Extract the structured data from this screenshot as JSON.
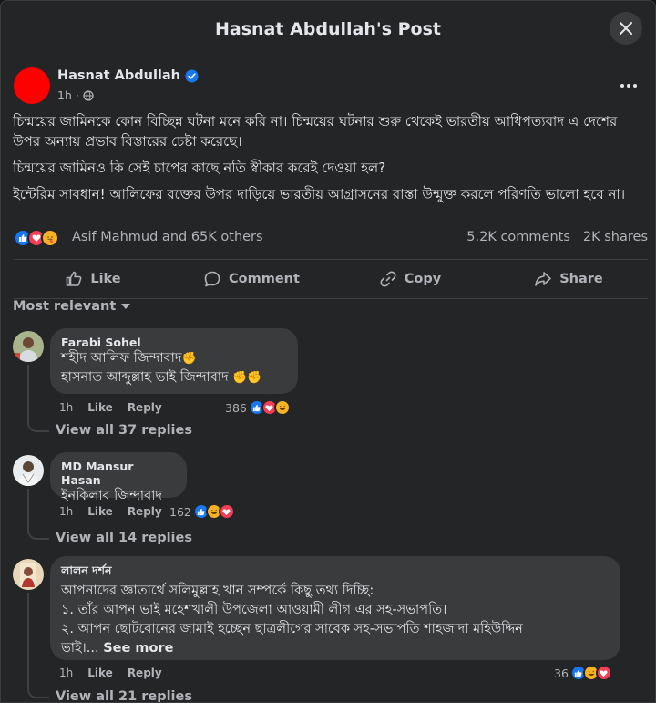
{
  "modal": {
    "title": "Hasnat Abdullah's Post"
  },
  "post": {
    "author": "Hasnat Abdullah",
    "time": "1h",
    "paragraphs": [
      "চিন্ময়ের জামিনকে কোন বিচ্ছিন্ন ঘটনা মনে করি না। চিন্ময়ের ঘটনার শুরু থেকেই ভারতীয় আধিপত্যবাদ এ দেশের উপর অন্যায় প্রভাব বিস্তারের চেষ্টা করেছে।",
      "চিন্ময়ের জামিনও কি সেই চাপের কাছে নতি স্বীকার করেই দেওয়া হল?",
      "ইন্টেরিম সাবধান! আলিফের রক্তের উপর দাড়িয়ে ভারতীয় আগ্রাসনের রাস্তা উন্মুক্ত করলে পরিণতি ভালো হবে না।"
    ],
    "reactions_text": "Asif Mahmud and 65K others",
    "comments_count": "5.2K comments",
    "shares_count": "2K shares"
  },
  "actions": {
    "like": "Like",
    "comment": "Comment",
    "copy": "Copy",
    "share": "Share"
  },
  "filter": {
    "label": "Most relevant"
  },
  "comments": [
    {
      "name": "Farabi Sohel",
      "lines": [
        "শহীদ আলিফ জিন্দাবাদ",
        "হাসনাত আব্দুল্লাহ ভাই জিন্দাবাদ"
      ],
      "time": "1h",
      "like": "Like",
      "reply": "Reply",
      "react_count": "386",
      "view_replies": "View all 37 replies"
    },
    {
      "name": "MD Mansur Hasan",
      "lines": [
        "ইনকিলাব জিন্দাবাদ"
      ],
      "time": "1h",
      "like": "Like",
      "reply": "Reply",
      "react_count": "162",
      "view_replies": "View all 14 replies"
    },
    {
      "name": "লালন দর্শন",
      "lines": [
        "আপনাদের জ্ঞাতার্থে সলিমুল্লাহ খান সম্পর্কে কিছু তথ্য দিচ্ছি:",
        "১. তাঁর আপন ভাই মহেশখালী উপজেলা আওয়ামী লীগ এর সহ-সভাপতি।",
        "২. আপন ছোটবোনের জামাই হচ্ছেন ছাত্রলীগের সাবেক সহ-সভাপতি শাহজাদা মহিউদ্দিন",
        "ভাই।..."
      ],
      "see_more": "See more",
      "time": "1h",
      "like": "Like",
      "reply": "Reply",
      "react_count": "36",
      "view_replies": "View all 21 replies"
    }
  ]
}
